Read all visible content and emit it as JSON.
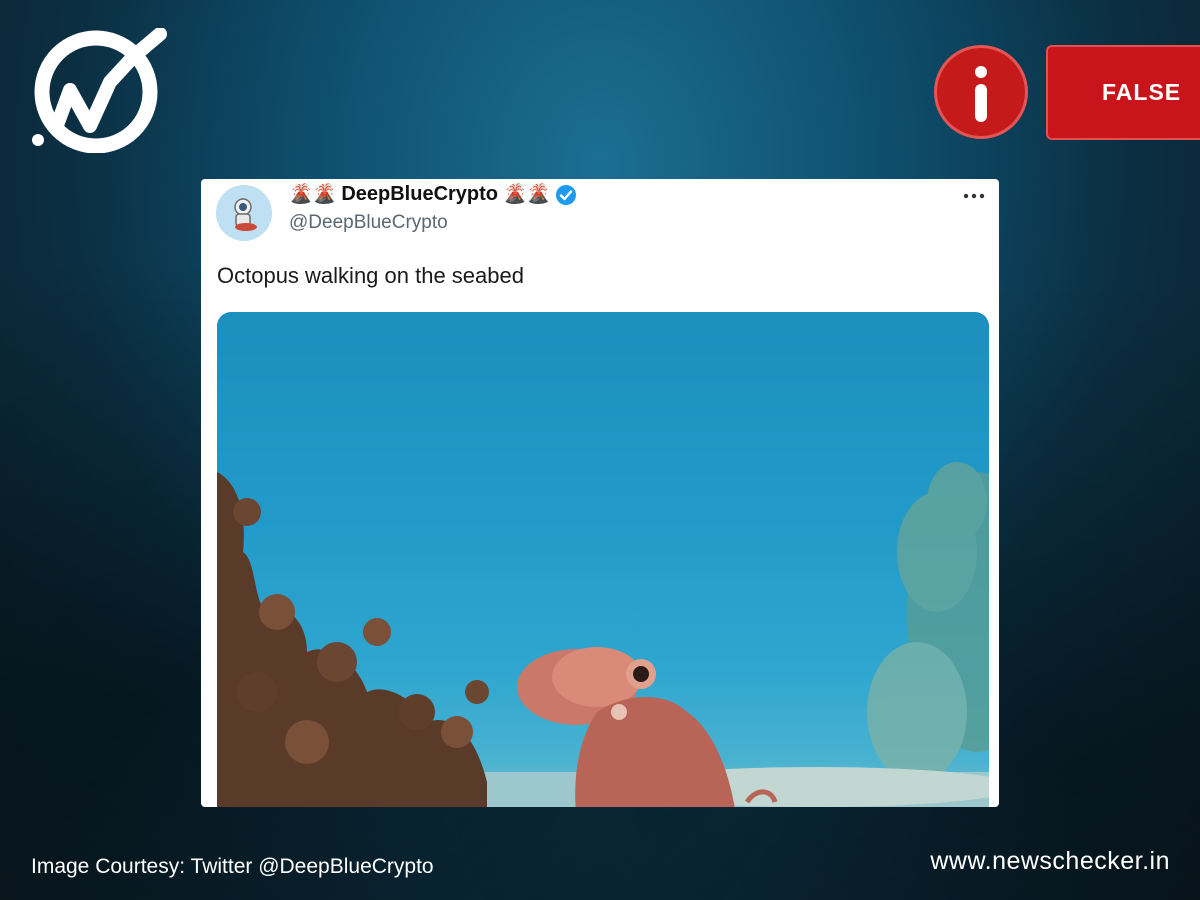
{
  "verdict": {
    "label": "FALSE",
    "color": "#c8141a"
  },
  "tweet": {
    "name_emoji_left": "🌋🌋",
    "display_name": "DeepBlueCrypto",
    "name_emoji_right": "🌋🌋",
    "handle": "@DeepBlueCrypto",
    "text": "Octopus walking on the seabed",
    "more_icon": "more-horizontal-icon",
    "verified_icon": "verified-badge-icon"
  },
  "footer": {
    "courtesy": "Image Courtesy: Twitter @DeepBlueCrypto",
    "site_url": "www.newschecker.in"
  },
  "colors": {
    "accent_red": "#c8141a",
    "verified_blue": "#1d9bf0"
  }
}
